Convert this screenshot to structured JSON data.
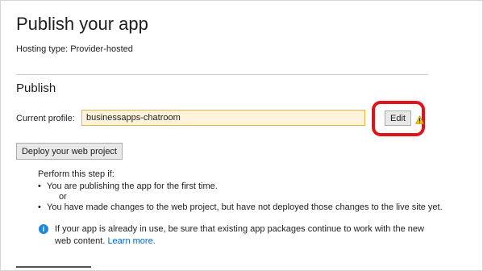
{
  "page": {
    "title": "Publish your app",
    "hosting_type": "Hosting type: Provider-hosted"
  },
  "publish": {
    "section_title": "Publish",
    "profile_label": "Current profile:",
    "profile_value": "businessapps-chatroom",
    "edit_label": "Edit",
    "deploy_label": "Deploy your web project",
    "step_intro": "Perform this step if:",
    "bullet_1": "You are publishing the app for the first time.",
    "or_text": "or",
    "bullet_2": "You have made changes to the web project, but have not deployed those changes to the live site yet.",
    "info_text": "If your app is already in use, be sure that existing app packages continue to work with the new web content.",
    "learn_more": "Learn more."
  },
  "icons": {
    "warning": "warning-icon",
    "info": "info-icon"
  },
  "colors": {
    "highlight": "#e1131a",
    "input_border": "#e8b24a",
    "input_bg": "#fff3dc",
    "link": "#0066cc"
  }
}
